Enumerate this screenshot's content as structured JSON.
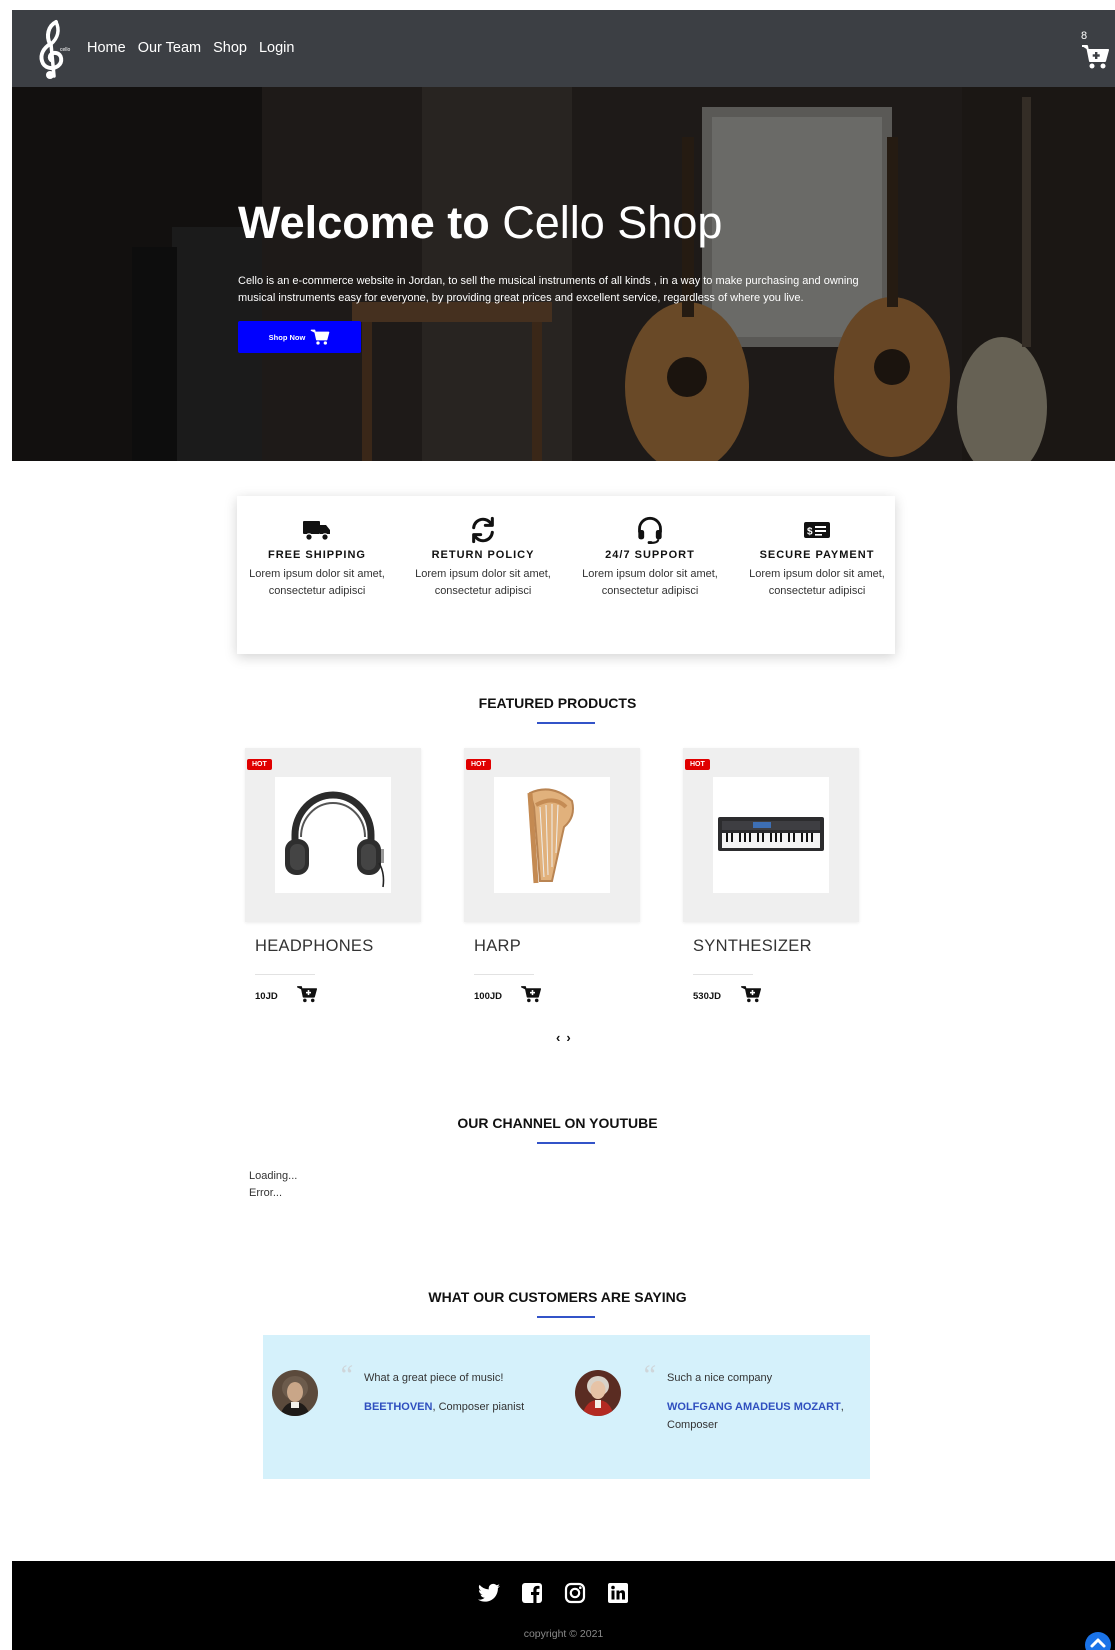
{
  "nav": {
    "logo_text": "cello",
    "links": [
      "Home",
      "Our Team",
      "Shop",
      "Login"
    ],
    "cart_count": "8"
  },
  "hero": {
    "title_bold": "Welcome to",
    "title_light": "Cello Shop",
    "description": "Cello is an e-commerce website in Jordan, to sell the musical instruments of all kinds , in a way to make purchasing and owning musical instruments easy for everyone, by providing great prices and excellent service, regardless of where you live.",
    "button_label": "Shop Now"
  },
  "features": [
    {
      "title": "FREE SHIPPING",
      "text": "Lorem ipsum dolor sit amet, consectetur adipisci",
      "icon": "truck-icon"
    },
    {
      "title": "RETURN POLICY",
      "text": "Lorem ipsum dolor sit amet, consectetur adipisci",
      "icon": "refresh-icon"
    },
    {
      "title": "24/7 SUPPORT",
      "text": "Lorem ipsum dolor sit amet, consectetur adipisci",
      "icon": "headset-icon"
    },
    {
      "title": "SECURE PAYMENT",
      "text": "Lorem ipsum dolor sit amet, consectetur adipisci",
      "icon": "money-check-icon"
    }
  ],
  "featured": {
    "title": "FEATURED PRODUCTS",
    "products": [
      {
        "name": "HEADPHONES",
        "price": "10JD",
        "badge": "HOT",
        "image": "headphones"
      },
      {
        "name": "HARP",
        "price": "100JD",
        "badge": "HOT",
        "image": "harp"
      },
      {
        "name": "SYNTHESIZER",
        "price": "530JD",
        "badge": "HOT",
        "image": "synthesizer"
      }
    ],
    "prev": "‹",
    "next": "›"
  },
  "youtube": {
    "title": "OUR CHANNEL ON YOUTUBE",
    "loading": "Loading...",
    "error": "Error..."
  },
  "testimonials": {
    "title": "WHAT OUR CUSTOMERS ARE SAYING",
    "items": [
      {
        "quote": "What a great piece of music!",
        "author": "BEETHOVEN",
        "role": ", Composer pianist"
      },
      {
        "quote": "Such a nice company",
        "author": "WOLFGANG AMADEUS MOZART",
        "role": ",",
        "role2": "Composer"
      }
    ]
  },
  "footer": {
    "socials": [
      "twitter-icon",
      "facebook-icon",
      "instagram-icon",
      "linkedin-icon"
    ],
    "copyright": "copyright © 2021"
  },
  "colors": {
    "navbar": "#3c3f44",
    "accent_blue": "#0000ff",
    "title_underline": "#3353c8",
    "hot_badge": "#e00000",
    "testimonial_bg": "#d5f1fb",
    "author_link": "#2f4fbf",
    "footer": "#000000"
  }
}
